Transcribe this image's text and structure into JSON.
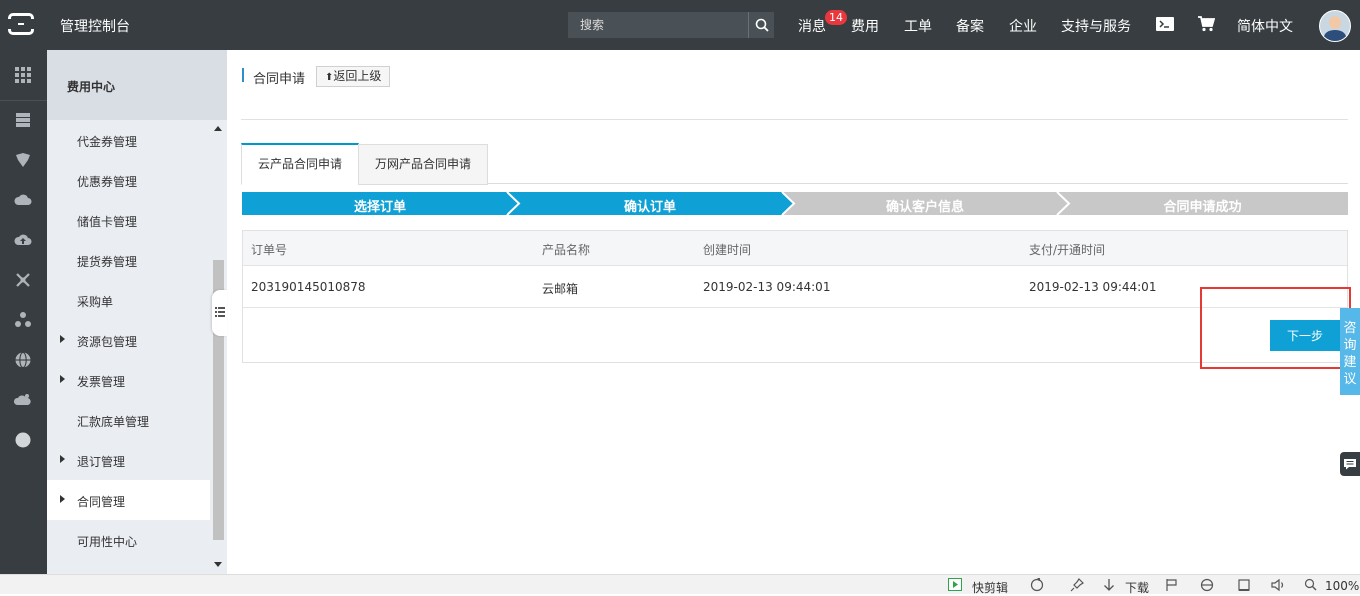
{
  "topbar": {
    "app_title": "管理控制台",
    "search_placeholder": "搜索",
    "nav": {
      "messages": "消息",
      "messages_badge": "14",
      "billing": "费用",
      "tickets": "工单",
      "icp": "备案",
      "enterprise": "企业",
      "support": "支持与服务",
      "language": "简体中文"
    }
  },
  "sidebar": {
    "title": "费用中心",
    "items": [
      {
        "label": "代金券管理"
      },
      {
        "label": "优惠券管理"
      },
      {
        "label": "储值卡管理"
      },
      {
        "label": "提货券管理"
      },
      {
        "label": "采购单"
      },
      {
        "label": "资源包管理"
      },
      {
        "label": "发票管理"
      },
      {
        "label": "汇款底单管理"
      },
      {
        "label": "退订管理"
      },
      {
        "label": "合同管理"
      },
      {
        "label": "可用性中心"
      }
    ]
  },
  "main": {
    "page_title": "合同申请",
    "back_label": "返回上级",
    "tabs": [
      {
        "label": "云产品合同申请"
      },
      {
        "label": "万网产品合同申请"
      }
    ],
    "steps": [
      {
        "label": "选择订单",
        "state": "done"
      },
      {
        "label": "确认订单",
        "state": "active"
      },
      {
        "label": "确认客户信息",
        "state": "todo"
      },
      {
        "label": "合同申请成功",
        "state": "todo"
      }
    ],
    "table": {
      "headers": [
        "订单号",
        "产品名称",
        "创建时间",
        "支付/开通时间"
      ],
      "rows": [
        [
          "203190145010878",
          "云邮箱",
          "2019-02-13 09:44:01",
          "2019-02-13 09:44:01"
        ]
      ]
    },
    "next_label": "下一步"
  },
  "feedback": {
    "label": "咨询建议"
  },
  "statusbar": {
    "quick_clip": "快剪辑",
    "download": "下载",
    "zoom": "100%"
  },
  "colors": {
    "topbar_bg": "#373d41",
    "step_active": "#0fa1d5",
    "step_todo": "#c8c8c8",
    "highlight": "#e53935",
    "badge": "#e8383d"
  }
}
